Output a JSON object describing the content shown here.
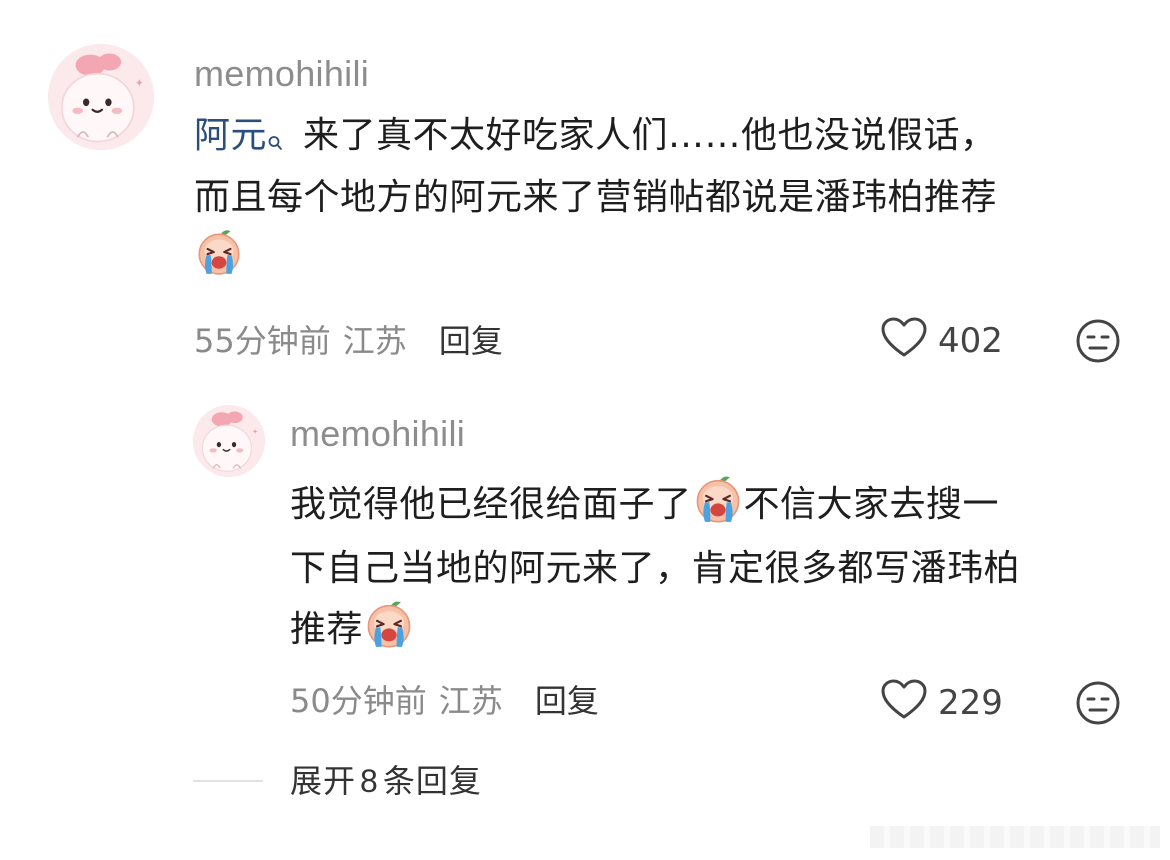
{
  "comment": {
    "username": "memohihili",
    "mention": "阿元",
    "mention_icon": "search-icon",
    "text_line1": " 来了真不太好吃家人们……他也没说假话，",
    "text_line2": "而且每个地方的阿元来了营销帖都说是潘玮柏推荐",
    "trailing_emoji": "crying-face-emoji",
    "time": "55分钟前",
    "location": "江苏",
    "reply_label": "回复",
    "like_count": "402",
    "like_icon": "heart-outline-icon",
    "dislike_icon": "unamused-face-icon"
  },
  "reply": {
    "username": "memohihili",
    "text_line1a": "我觉得他已经很给面子了",
    "text_line1b": "不信大家去搜一",
    "text_line2": "下自己当地的阿元来了，肯定很多都写潘玮柏",
    "text_line3": "推荐",
    "inline_emoji": "crying-face-emoji",
    "time": "50分钟前",
    "location": "江苏",
    "reply_label": "回复",
    "like_count": "229",
    "like_icon": "heart-outline-icon",
    "dislike_icon": "unamused-face-icon"
  },
  "expand": {
    "label_pre": "展开",
    "count": "8",
    "label_post": "条回复"
  },
  "colors": {
    "mention": "#2b4f7a",
    "username": "#8d8d8d",
    "meta": "#8a8a8a",
    "avatar_bg": "#fbe9ec"
  }
}
